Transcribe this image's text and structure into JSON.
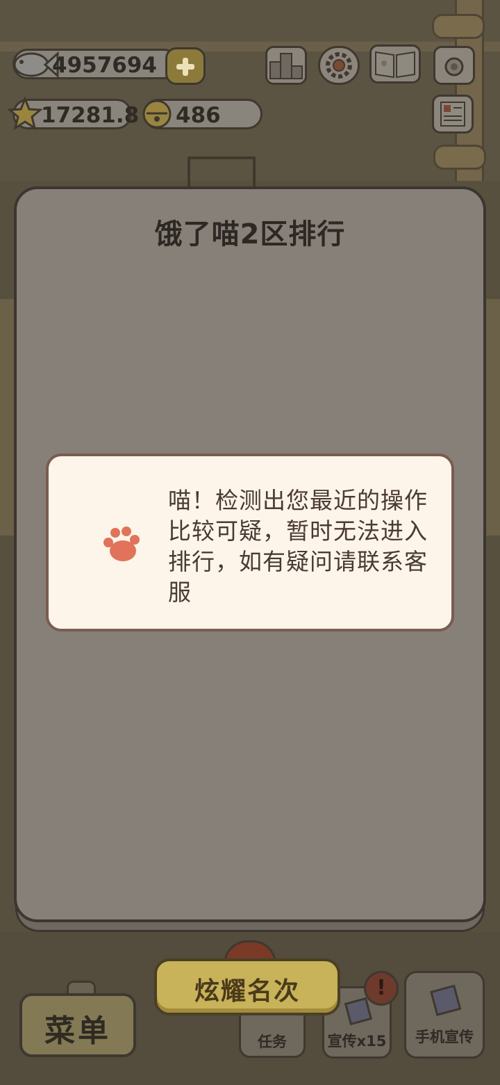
{
  "resources": {
    "fish_count": "4957694",
    "star_count": "17281.8",
    "bell_count": "486"
  },
  "top_icons": [
    "ranking-icon",
    "settings-gear-icon",
    "book-icon",
    "camera-icon",
    "notebook-icon"
  ],
  "modal": {
    "title": "饿了喵2区排行",
    "message_lines": [
      "喵！检测出您最近的操作",
      "比较可疑，暂时无法进入",
      "排行，如有疑问请联系客",
      "服"
    ]
  },
  "bottom_bar": {
    "menu_label": "菜单",
    "show_rank_label": "炫耀名次",
    "task_label": "任务",
    "promo_label": "宣传x15",
    "phone_promo_label": "手机宣传",
    "alert_mark": "!"
  },
  "colors": {
    "modal_bg": "#878079",
    "message_bg": "#fdf5ea",
    "paw": "#e0735a",
    "primary_button": "#c8b25a"
  }
}
